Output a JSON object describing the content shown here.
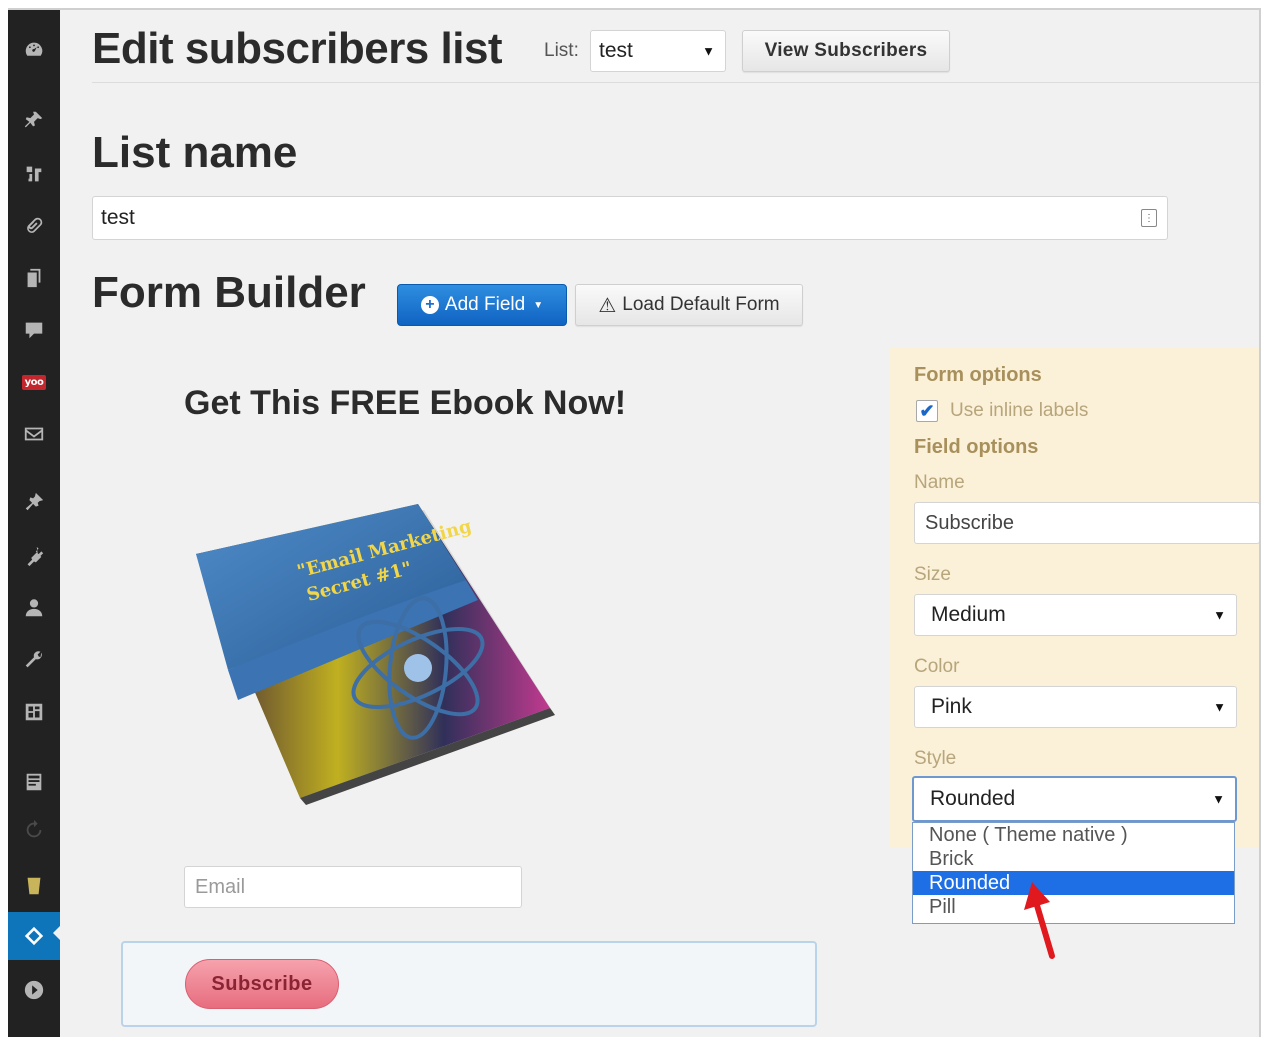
{
  "header": {
    "title": "Edit subscribers list",
    "list_label": "List:",
    "list_select_value": "test",
    "view_subscribers_label": "View Subscribers"
  },
  "list_name": {
    "heading": "List name",
    "value": "test"
  },
  "form_builder": {
    "heading": "Form Builder",
    "add_field_label": "Add Field",
    "load_default_label": "Load Default Form"
  },
  "preview": {
    "heading": "Get This FREE Ebook Now!",
    "email_placeholder": "Email",
    "subscribe_label": "Subscribe"
  },
  "options": {
    "form_options_heading": "Form options",
    "use_inline_labels_label": "Use inline labels",
    "use_inline_labels_checked": true,
    "field_options_heading": "Field options",
    "name_label": "Name",
    "name_value": "Subscribe",
    "size_label": "Size",
    "size_value": "Medium",
    "color_label": "Color",
    "color_value": "Pink",
    "style_label": "Style",
    "style_value": "Rounded",
    "style_options": [
      "None ( Theme native )",
      "Brick",
      "Rounded",
      "Pill"
    ]
  },
  "sidebar": {
    "icons": [
      "dashboard-icon",
      "pin-icon",
      "media-icon",
      "links-icon",
      "pages-icon",
      "comments-icon",
      "yoo-icon",
      "mail-icon",
      "appearance-icon",
      "plugins-icon",
      "users-icon",
      "tools-icon",
      "settings-icon",
      "form-icon",
      "refresh-icon",
      "badge-icon",
      "subscribers-icon",
      "play-icon"
    ],
    "yoo_label": "yoo",
    "active_icon": "subscribers-icon"
  },
  "colors": {
    "primary_button": "#1063c2",
    "subscribe_pink": "#e76d7e",
    "options_panel_bg": "#fbf1d8",
    "selected_option": "#1e6fe6"
  }
}
